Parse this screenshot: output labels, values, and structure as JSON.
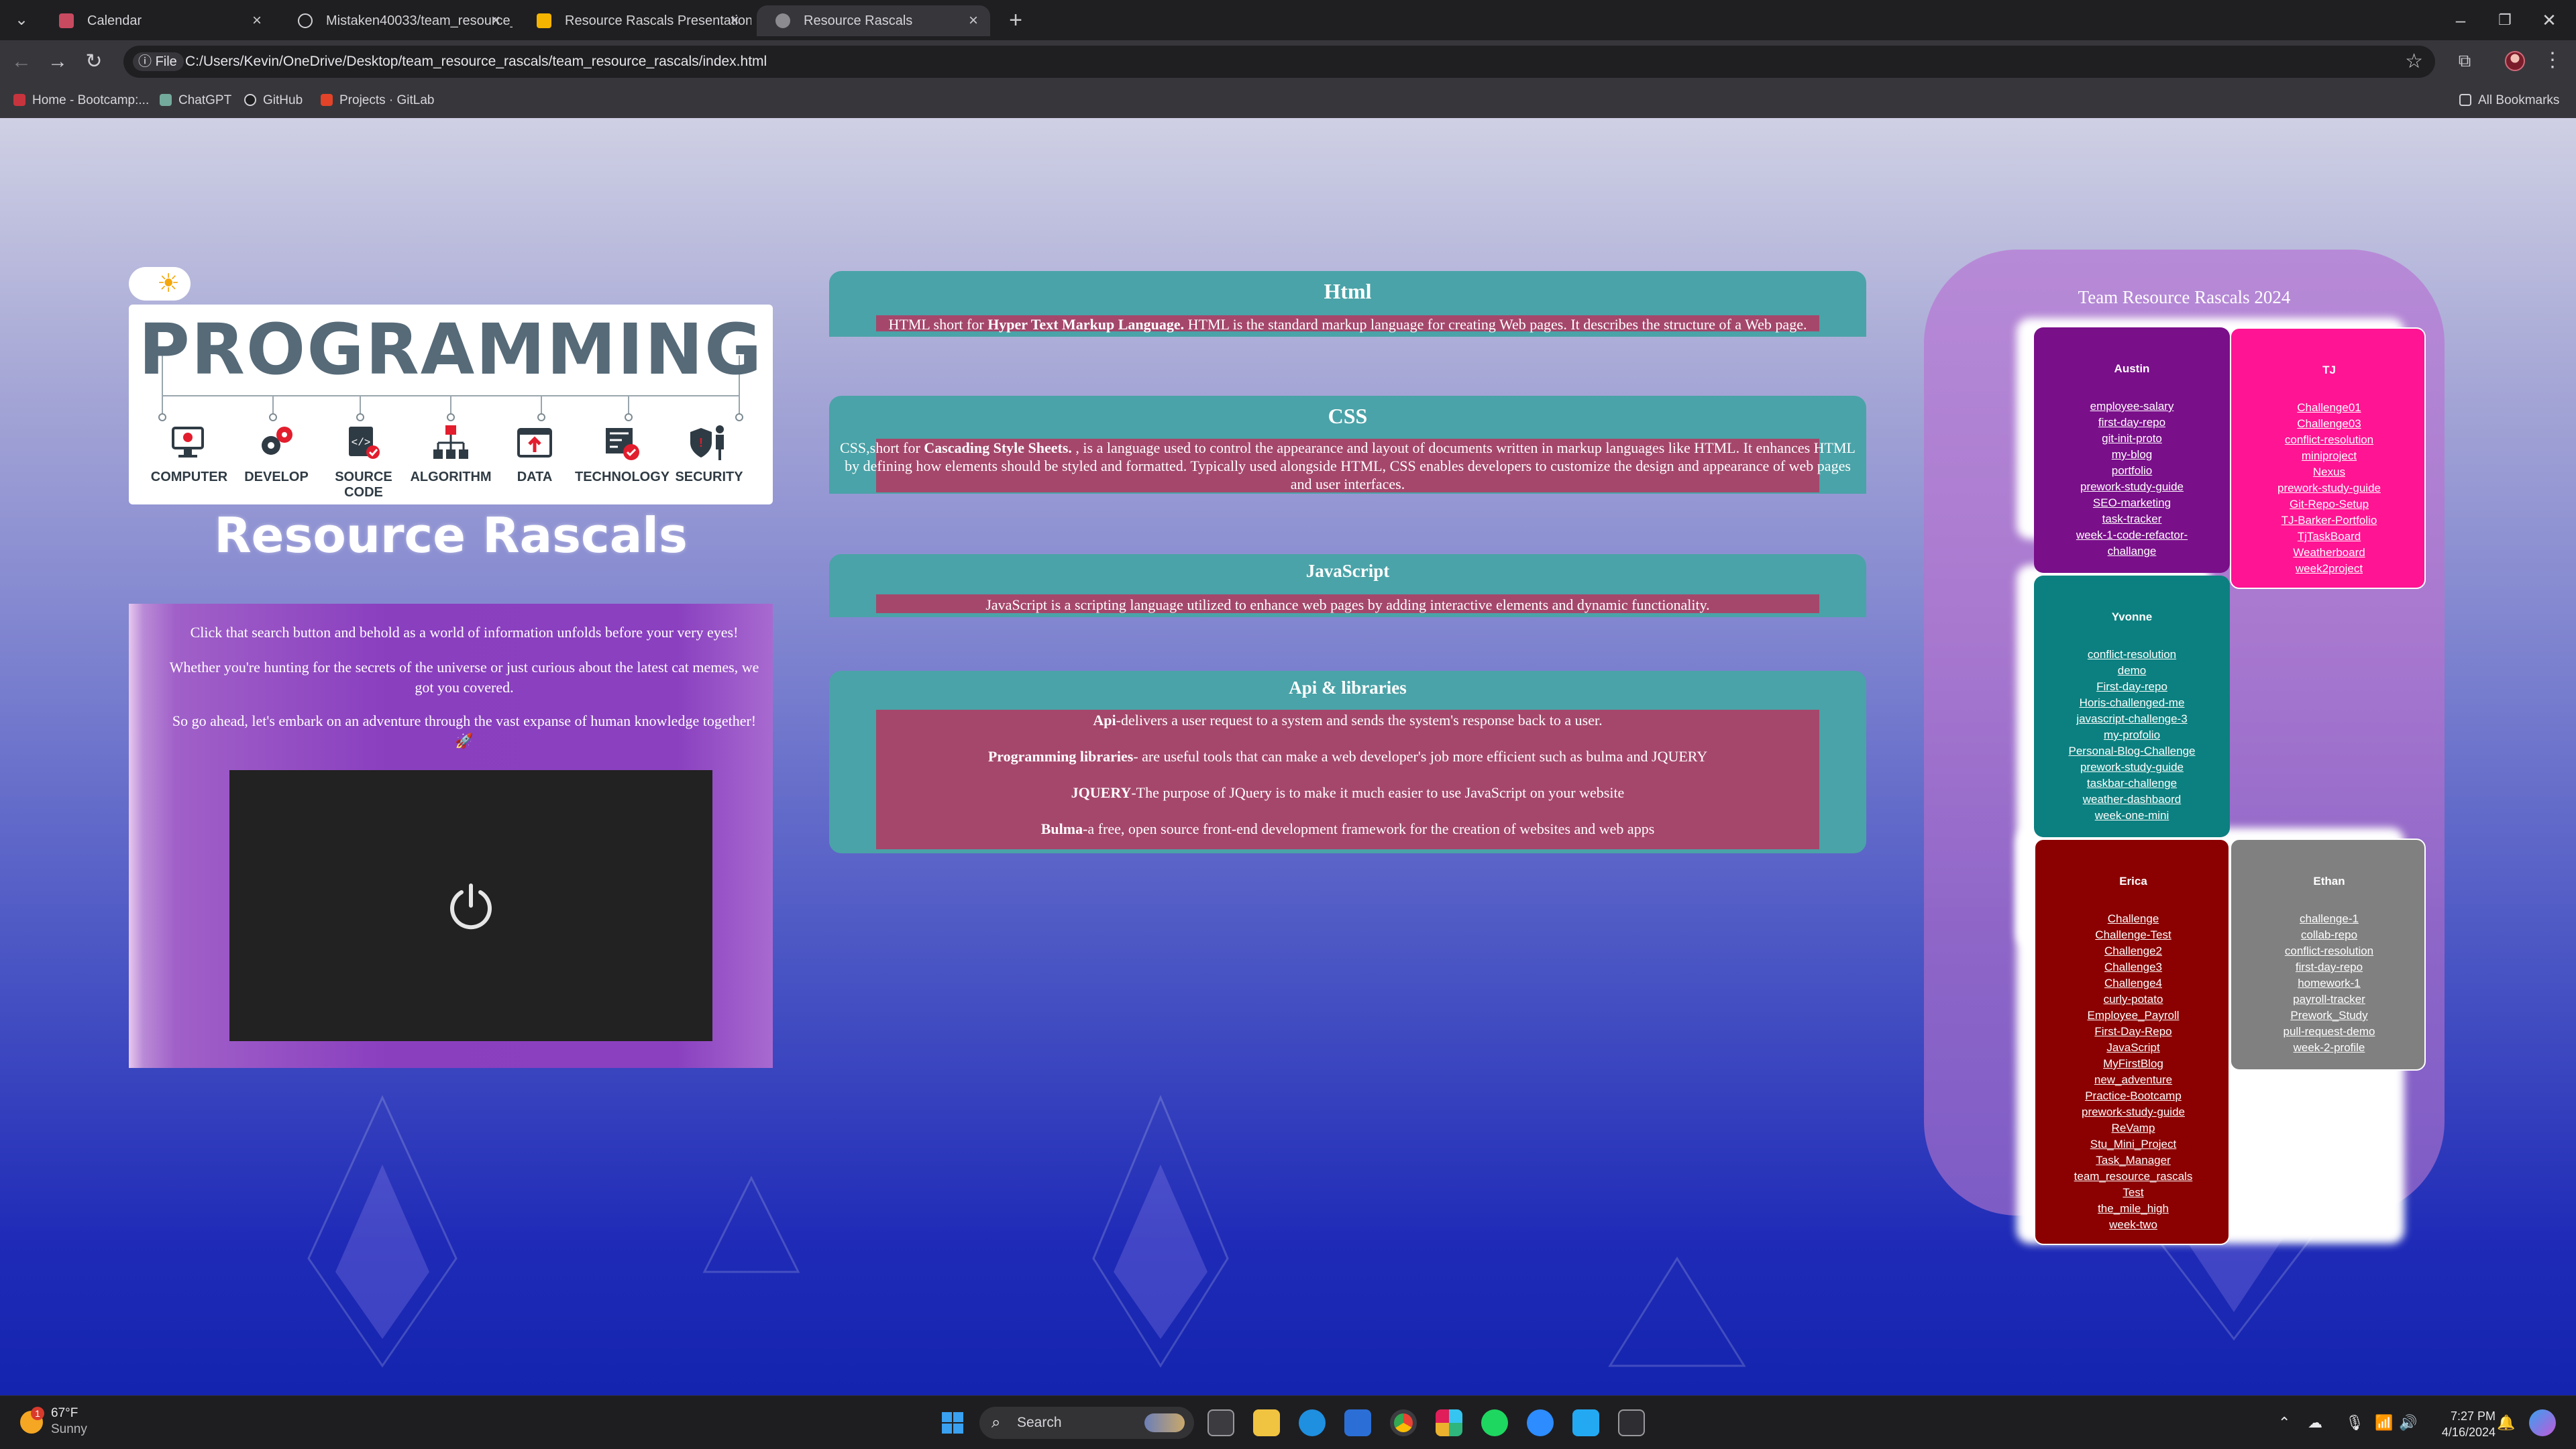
{
  "browser": {
    "tabs": [
      {
        "label": "Calendar",
        "favicon_color": "#c84a61"
      },
      {
        "label": "Mistaken40033/team_resource_",
        "favicon_color": "#1f1f22"
      },
      {
        "label": "Resource Rascals Presentation",
        "favicon_color": "#f5b400"
      },
      {
        "label": "Resource Rascals",
        "favicon_color": "#8c8c90"
      }
    ],
    "address": {
      "badge": "File",
      "url": "C:/Users/Kevin/OneDrive/Desktop/team_resource_rascals/team_resource_rascals/index.html"
    },
    "bookmarks": [
      {
        "label": "Home - Bootcamp:...",
        "color": "#c8343e"
      },
      {
        "label": "ChatGPT",
        "color": "#74aa9c"
      },
      {
        "label": "GitHub",
        "color": "#1f1f22"
      },
      {
        "label": "Projects · GitLab",
        "color": "#e24329"
      }
    ],
    "all_bookmarks": "All Bookmarks"
  },
  "page": {
    "banner": {
      "title": "PROGRAMMING",
      "items": [
        "COMPUTER",
        "DEVELOP",
        "SOURCE CODE",
        "ALGORITHM",
        "DATA",
        "TECHNOLOGY",
        "SECURITY"
      ]
    },
    "brand": "Resource Rascals",
    "intro": [
      "Click that search button and behold as a world of information unfolds before your very eyes!",
      "Whether you're hunting for the secrets of the universe or just curious about the latest cat memes, we got you covered.",
      "So go ahead, let's embark on an adventure through the vast expanse of human knowledge together! 🚀"
    ],
    "sections": {
      "html": {
        "title": "Html",
        "pre": "HTML short for ",
        "bold": "Hyper Text Markup Language.",
        "post": " HTML is the standard markup language for creating Web pages. It describes the structure of a Web page."
      },
      "css": {
        "title": "CSS",
        "pre": "CSS,short for ",
        "bold": "Cascading Style Sheets.",
        "post": " , is a language used to control the appearance and layout of documents written in markup languages like HTML. It enhances HTML by defining how elements should be styled and formatted. Typically used alongside HTML, CSS enables developers to customize the design and appearance of web pages and user interfaces."
      },
      "js": {
        "title": "JavaScript",
        "text": "JavaScript is a scripting language utilized to enhance web pages by adding interactive elements and dynamic functionality."
      },
      "api": {
        "title": "Api & libraries",
        "items": [
          {
            "bold": "Api",
            "text": "-delivers a user request to a system and sends the system's response back to a user."
          },
          {
            "bold": "Programming libraries",
            "text": "- are useful tools that can make a web developer's job more efficient such as bulma and JQUERY"
          },
          {
            "bold": "JQUERY",
            "text": "-The purpose of JQuery is to make it much easier to use JavaScript on your website"
          },
          {
            "bold": "Bulma",
            "text": "-a free, open source front-end development framework for the creation of websites and web apps"
          }
        ]
      }
    },
    "team": {
      "title": "Team Resource Rascals 2024",
      "members": [
        {
          "name": "Austin",
          "color": "#7a0f8a",
          "links": [
            "employee-salary",
            "first-day-repo",
            "git-init-proto",
            "my-blog",
            "portfolio",
            "prework-study-guide",
            "SEO-marketing",
            "task-tracker",
            "week-1-code-refactor-",
            "challange"
          ]
        },
        {
          "name": "TJ",
          "color": "#ff1493",
          "links": [
            "Challenge01",
            "Challenge03",
            "conflict-resolution",
            "miniproject",
            "Nexus",
            "prework-study-guide",
            "Git-Repo-Setup",
            "TJ-Barker-Portfolio",
            "TjTaskBoard",
            "Weatherboard",
            "week2project"
          ]
        },
        {
          "name": "Yvonne",
          "color": "#0c8080",
          "links": [
            "conflict-resolution",
            "demo",
            "First-day-repo",
            "Horis-challenged-me",
            "javascript-challenge-3",
            "my-profolio",
            "Personal-Blog-Challenge",
            "prework-study-guide",
            "taskbar-challenge",
            "weather-dashbaord",
            "week-one-mini"
          ]
        },
        {
          "name": "Erica",
          "color": "#8b0000",
          "links": [
            "Challenge",
            "Challenge-Test",
            "Challenge2",
            "Challenge3",
            "Challenge4",
            "curly-potato",
            "Employee_Payroll",
            "First-Day-Repo",
            "JavaScript",
            "MyFirstBlog",
            "new_adventure",
            "Practice-Bootcamp",
            "prework-study-guide",
            "ReVamp",
            "Stu_Mini_Project",
            "Task_Manager",
            "team_resource_rascals",
            "Test",
            "the_mile_high",
            "week-two"
          ]
        },
        {
          "name": "Ethan",
          "color": "#808080",
          "links": [
            "challenge-1",
            "collab-repo",
            "conflict-resolution",
            "first-day-repo",
            "homework-1",
            "payroll-tracker",
            "Prework_Study",
            "pull-request-demo",
            "week-2-profile"
          ]
        }
      ]
    }
  },
  "taskbar": {
    "weather_temp": "67°F",
    "weather_desc": "Sunny",
    "weather_badge": "1",
    "search_label": "Search",
    "time": "7:27 PM",
    "date": "4/16/2024"
  }
}
